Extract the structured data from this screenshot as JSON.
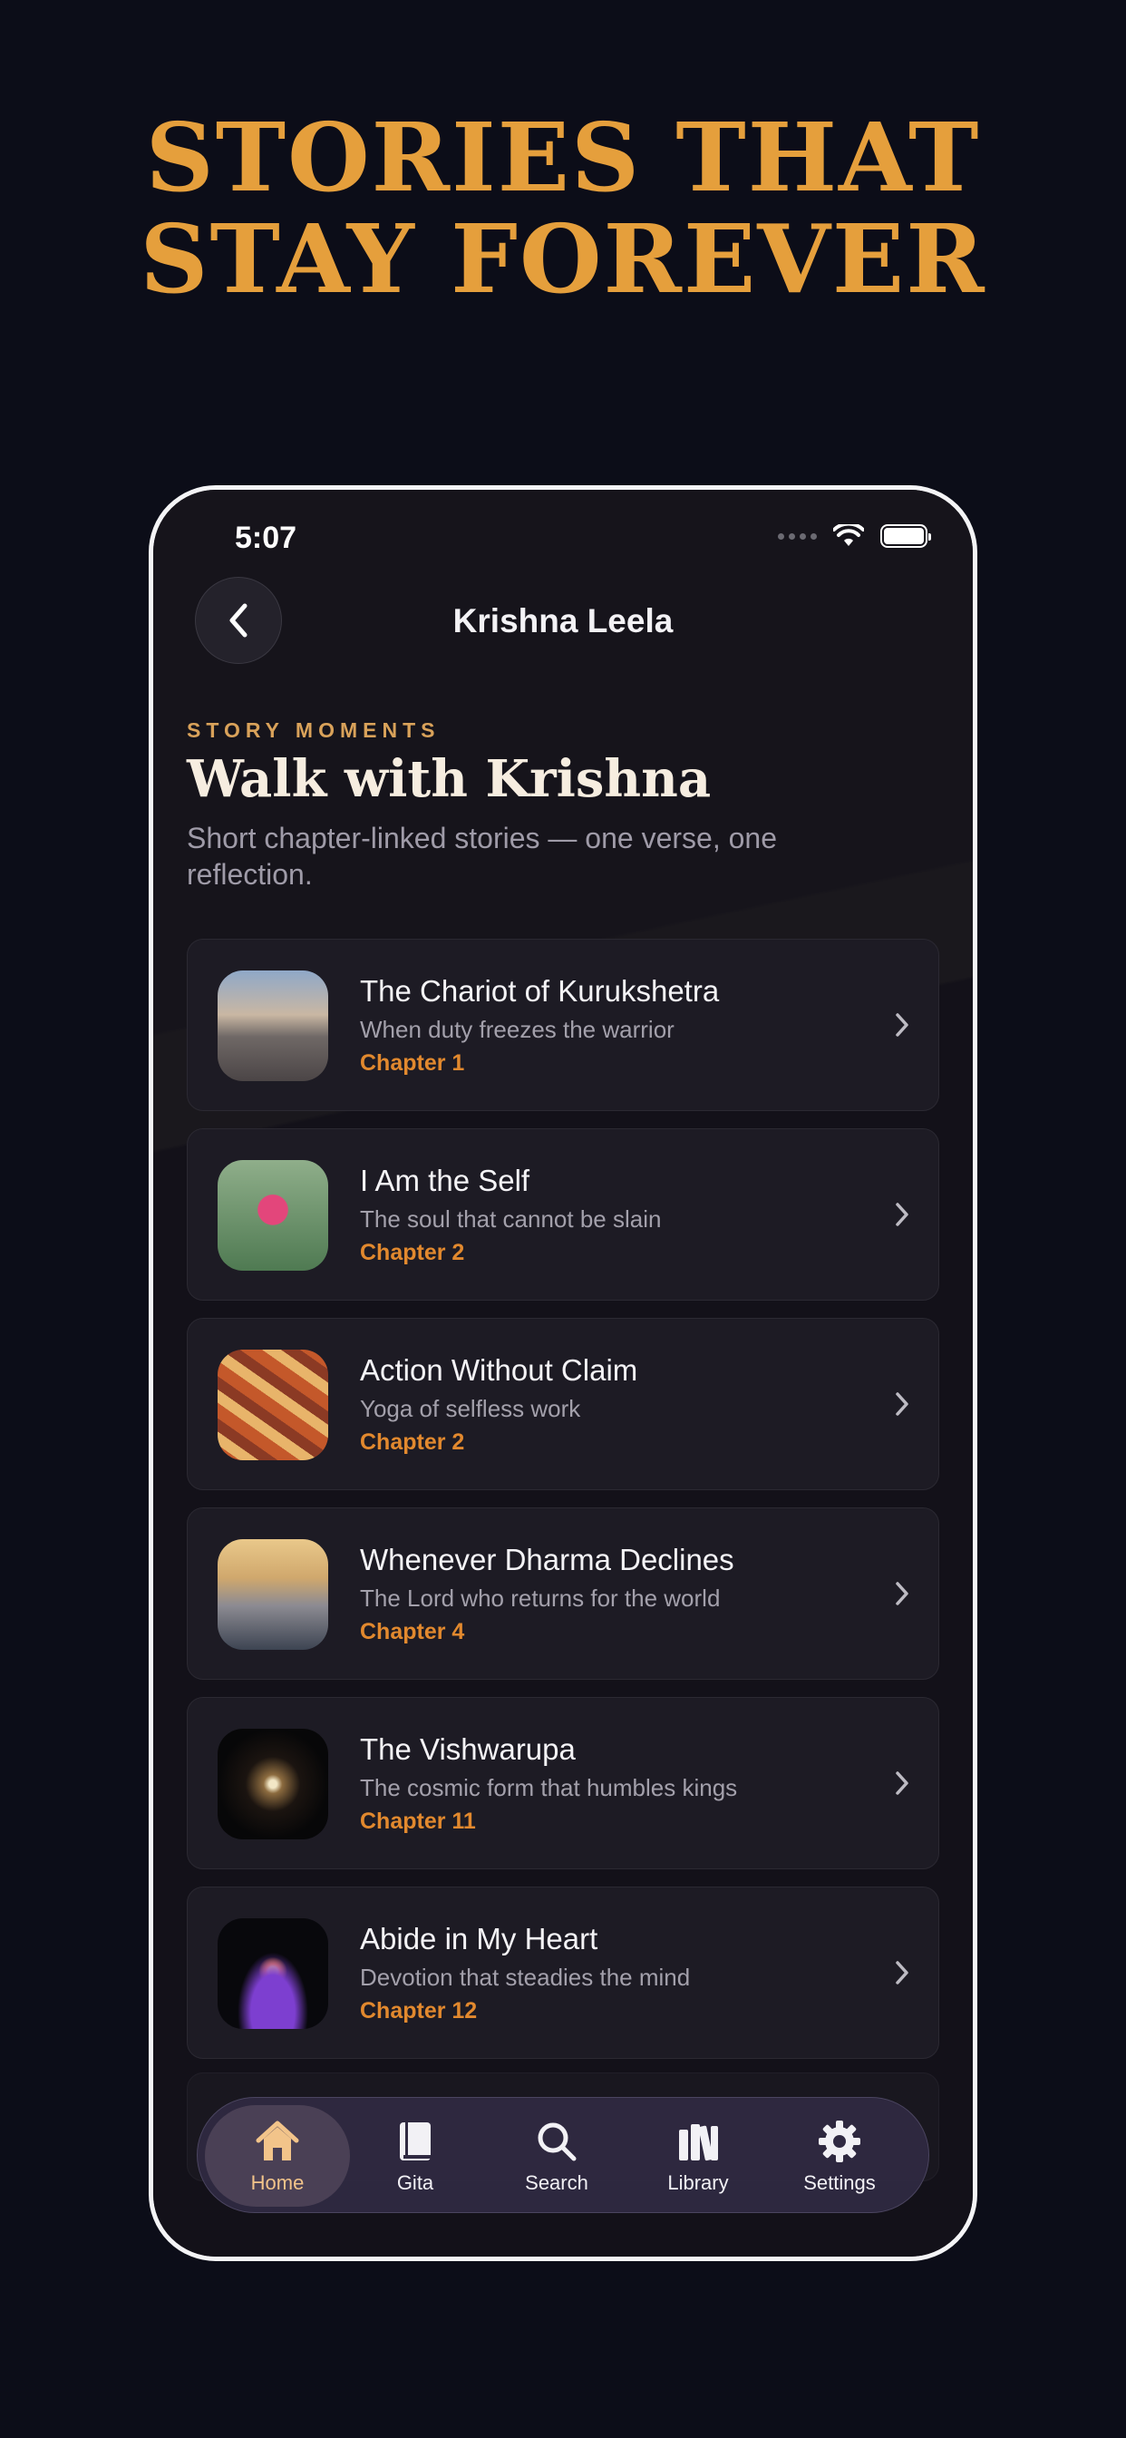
{
  "poster": {
    "headline_line1": "STORIES THAT",
    "headline_line2": "STAY FOREVER"
  },
  "status_bar": {
    "time": "5:07"
  },
  "nav": {
    "title": "Krishna Leela",
    "back_icon": "chevron-left-icon"
  },
  "header": {
    "eyebrow": "STORY MOMENTS",
    "heading": "Walk with Krishna",
    "subtitle": "Short chapter-linked stories — one verse, one reflection."
  },
  "stories": [
    {
      "title": "The Chariot of Kurukshetra",
      "description": "When duty freezes the warrior",
      "chapter": "Chapter 1"
    },
    {
      "title": "I Am the Self",
      "description": "The soul that cannot be slain",
      "chapter": "Chapter 2"
    },
    {
      "title": "Action Without Claim",
      "description": "Yoga of selfless work",
      "chapter": "Chapter 2"
    },
    {
      "title": "Whenever Dharma Declines",
      "description": "The Lord who returns for the world",
      "chapter": "Chapter 4"
    },
    {
      "title": "The Vishwarupa",
      "description": "The cosmic form that humbles kings",
      "chapter": "Chapter 11"
    },
    {
      "title": "Abide in My Heart",
      "description": "Devotion that steadies the mind",
      "chapter": "Chapter 12"
    }
  ],
  "tab_bar": {
    "items": [
      {
        "label": "Home",
        "icon": "home-icon",
        "active": true
      },
      {
        "label": "Gita",
        "icon": "book-icon",
        "active": false
      },
      {
        "label": "Search",
        "icon": "search-icon",
        "active": false
      },
      {
        "label": "Library",
        "icon": "library-icon",
        "active": false
      },
      {
        "label": "Settings",
        "icon": "gear-icon",
        "active": false
      }
    ]
  },
  "colors": {
    "accent_gold": "#e59f3c",
    "chapter_orange": "#e2892e",
    "background": "#0c0d18"
  }
}
